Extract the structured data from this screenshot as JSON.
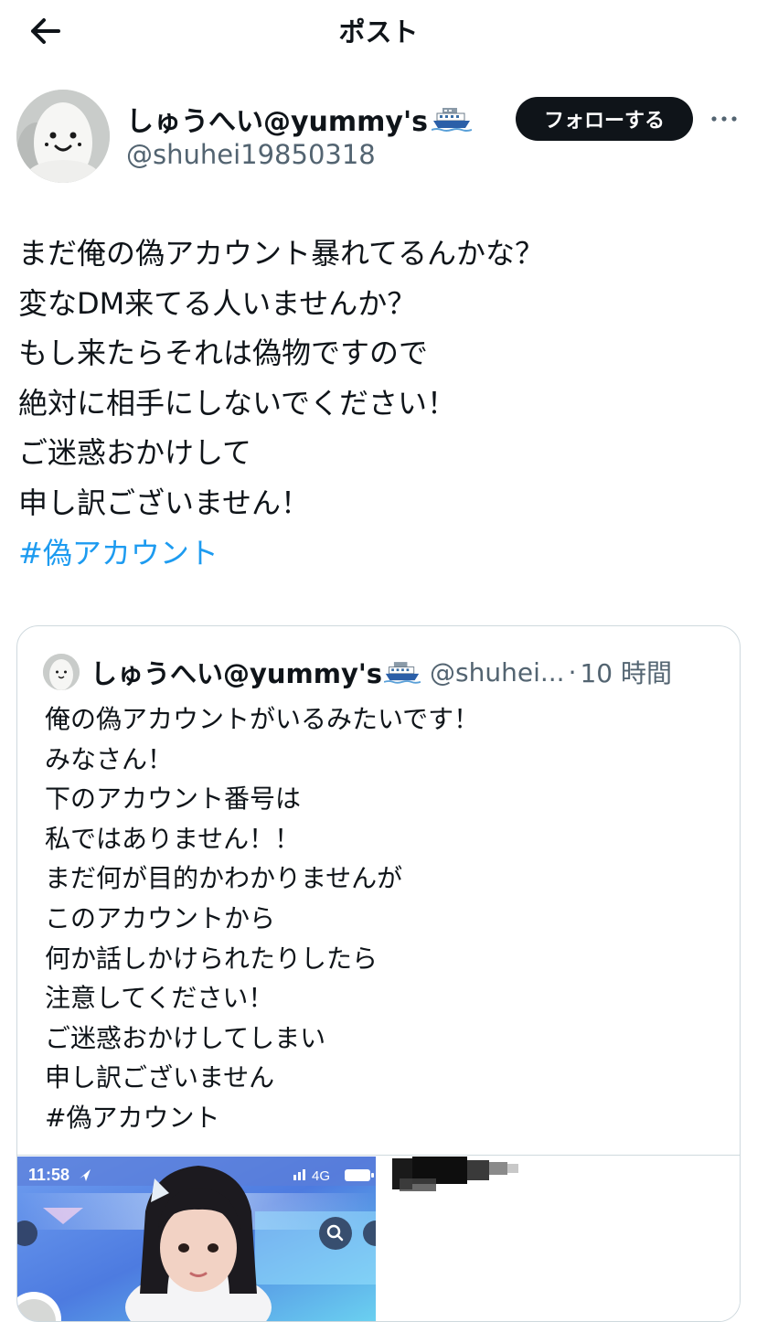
{
  "header": {
    "title": "ポスト"
  },
  "author": {
    "display_name": "しゅうへい@yummy's",
    "handle": "@shuhei19850318",
    "follow_label": "フォローする"
  },
  "post": {
    "lines": [
      "まだ俺の偽アカウント暴れてるんかな？",
      "変なDM来てる人いませんか？",
      "もし来たらそれは偽物ですので",
      "絶対に相手にしないでください！",
      "ご迷惑おかけして",
      "申し訳ございません！"
    ],
    "hashtag": "#偽アカウント"
  },
  "quote": {
    "display_name": "しゅうへい@yummy's",
    "handle": "@shuhei...",
    "separator": "·",
    "time": "10 時間",
    "lines": [
      "俺の偽アカウントがいるみたいです！",
      "みなさん！",
      "下のアカウント番号は",
      "私ではありません！！",
      "まだ何が目的かわかりませんが",
      "このアカウントから",
      "何か話しかけられたりしたら",
      "注意してください！",
      "ご迷惑おかけしてしまい",
      "申し訳ございません",
      "#偽アカウント"
    ],
    "media": {
      "status_time": "11:58",
      "network": "4G"
    }
  },
  "colors": {
    "link": "#1d9bf0",
    "text": "#0f1419",
    "secondary": "#536471",
    "button": "#0f1419",
    "border": "#cfd9de"
  },
  "icons": [
    "back-arrow-icon",
    "ship-icon",
    "more-icon",
    "location-arrow-icon",
    "signal-icon",
    "battery-icon",
    "search-icon"
  ]
}
